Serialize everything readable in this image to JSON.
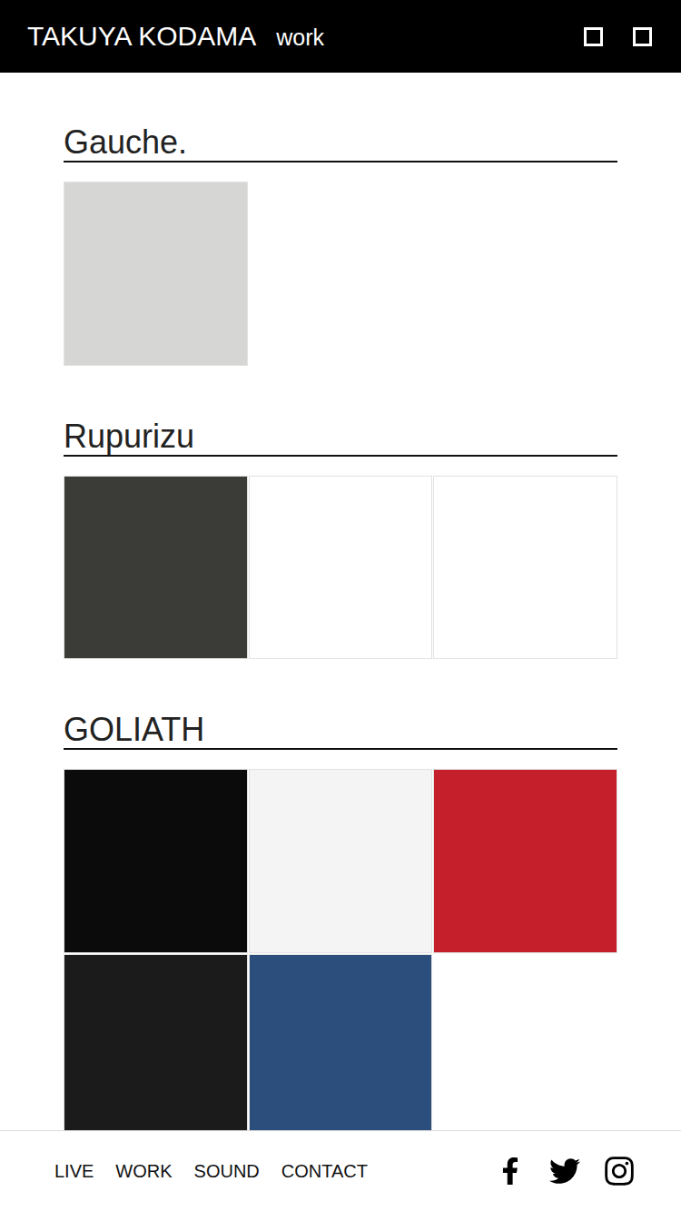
{
  "header": {
    "title": "TAKUYA KODAMA",
    "subtitle": "work"
  },
  "sections": [
    {
      "title": "Gauche.",
      "covers": [
        {
          "color": "#d6d6d4"
        }
      ]
    },
    {
      "title": "Rupurizu",
      "covers": [
        {
          "color": "#3b3c38"
        },
        {
          "color": "#ffffff"
        },
        {
          "color": "#ffffff"
        }
      ]
    },
    {
      "title": "GOLIATH",
      "covers": [
        {
          "color": "#0b0b0b"
        },
        {
          "color": "#f4f4f4"
        },
        {
          "color": "#c41f2a"
        },
        {
          "color": "#1b1b1b"
        },
        {
          "color": "#2b4e7c"
        }
      ]
    }
  ],
  "footer": {
    "links": [
      "LIVE",
      "WORK",
      "SOUND",
      "CONTACT"
    ]
  }
}
